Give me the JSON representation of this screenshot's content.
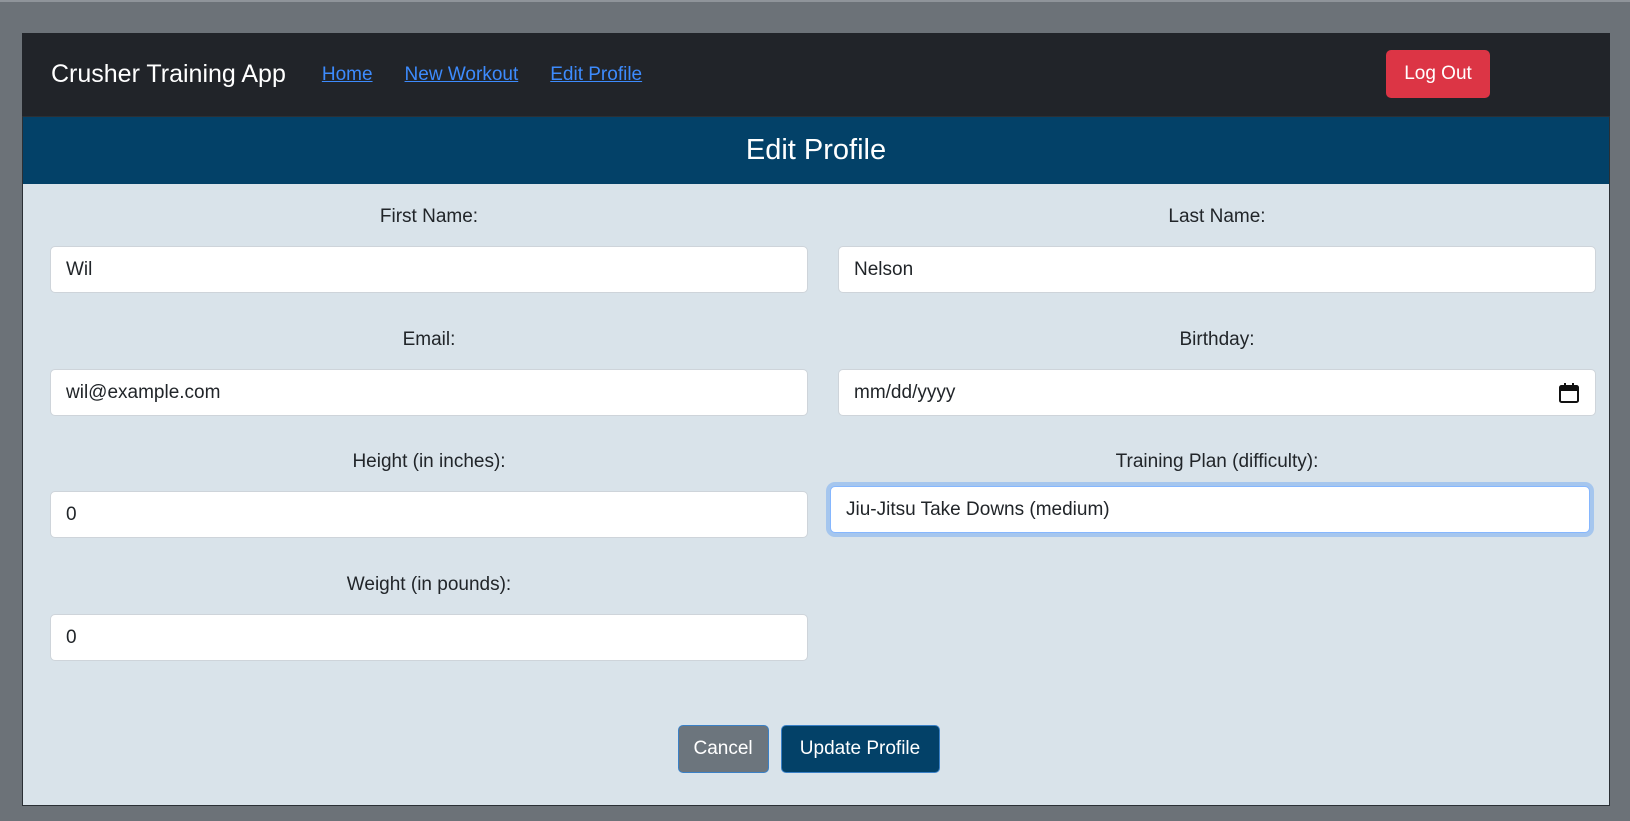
{
  "nav": {
    "brand": "Crusher Training App",
    "links": [
      "Home",
      "New Workout",
      "Edit Profile"
    ],
    "logout_label": "Log Out"
  },
  "page": {
    "title": "Edit Profile"
  },
  "form": {
    "first_name": {
      "label": "First Name:",
      "value": "Wil"
    },
    "last_name": {
      "label": "Last Name:",
      "value": "Nelson"
    },
    "email": {
      "label": "Email:",
      "value": "wil@example.com"
    },
    "birthday": {
      "label": "Birthday:",
      "placeholder": "mm/dd/yyyy"
    },
    "height": {
      "label": "Height (in inches):",
      "value": "0"
    },
    "training_plan": {
      "label": "Training Plan (difficulty):",
      "value": "Jiu-Jitsu Take Downs (medium)"
    },
    "weight": {
      "label": "Weight (in pounds):",
      "value": "0"
    }
  },
  "buttons": {
    "cancel": "Cancel",
    "update": "Update Profile"
  },
  "colors": {
    "navbar": "#212429",
    "header": "#034168",
    "logout": "#dc3545",
    "card_bg": "#d9e3ea",
    "link": "#3d8bfd"
  },
  "icons": {
    "birthday": "calendar-icon"
  }
}
